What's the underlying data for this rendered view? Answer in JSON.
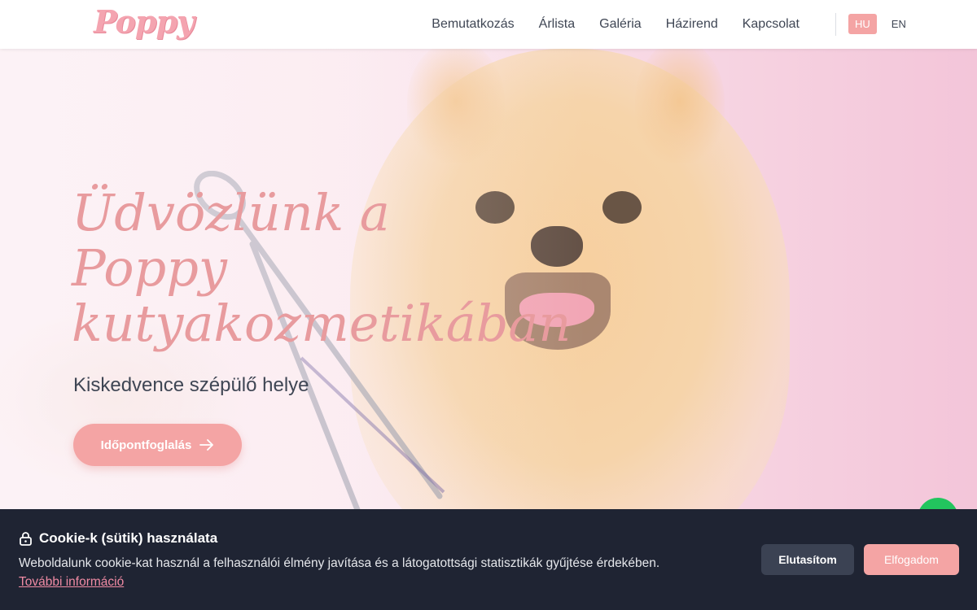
{
  "header": {
    "logo_text": "Poppy",
    "nav": [
      {
        "label": "Bemutatkozás"
      },
      {
        "label": "Árlista"
      },
      {
        "label": "Galéria"
      },
      {
        "label": "Házirend"
      },
      {
        "label": "Kapcsolat"
      }
    ],
    "languages": [
      {
        "label": "HU",
        "active": true
      },
      {
        "label": "EN",
        "active": false
      }
    ]
  },
  "hero": {
    "title_line1": "Üdvözlünk a",
    "title_line2": "Poppy",
    "title_line3": "kutyakozmetikában",
    "subtitle": "Kiskedvence szépülő helye",
    "cta_label": "Időpontfoglalás",
    "cta_icon": "arrow-right-icon"
  },
  "cookie": {
    "title": "Cookie-k (sütik) használata",
    "icon": "lock-icon",
    "text": "Weboldalunk cookie-kat használ a felhasználói élmény javítása és a látogatottsági statisztikák gyűjtése érdekében.",
    "link": "További információ",
    "decline_label": "Elutasítom",
    "accept_label": "Elfogadom"
  },
  "colors": {
    "accent": "#f4a4a4",
    "title_pink": "#e89b9e",
    "banner_bg": "#1f2433",
    "link_pink": "#f08ba4",
    "chat_green": "#22c55e"
  }
}
